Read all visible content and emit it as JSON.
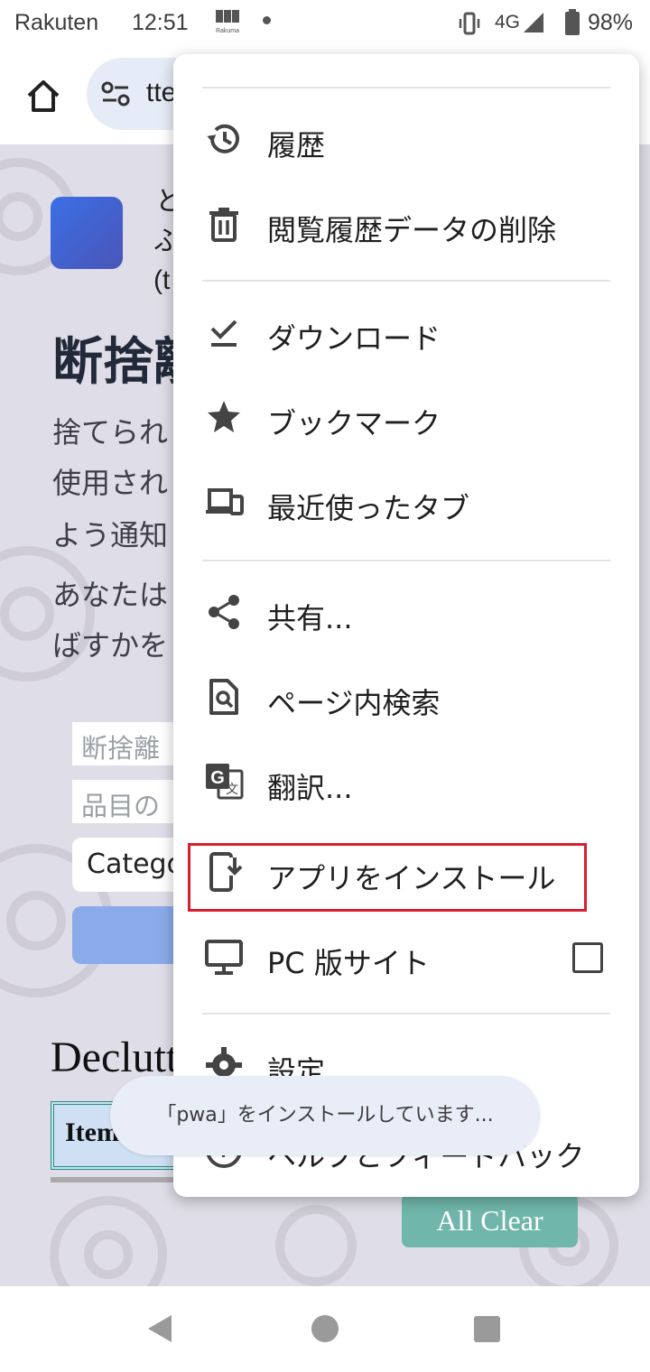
{
  "status_bar": {
    "carrier": "Rakuten",
    "time": "12:51",
    "app_icon_label": "Rakuma",
    "network": "4G",
    "battery_percent": "98%"
  },
  "toolbar": {
    "url_partial": "tte"
  },
  "page": {
    "header_lines": [
      "と",
      "ふ",
      "(t"
    ],
    "heading": "断捨離",
    "paragraph_lines": [
      "捨てられ",
      "使用され",
      "よう通知",
      "あなたは",
      "ばすかを"
    ],
    "field_1_placeholder": "断捨離",
    "field_2_placeholder": "品目の",
    "category_select": "Catego",
    "section_title": "Declutt",
    "table_header": "Item",
    "clear_button": "All Clear"
  },
  "menu": {
    "items": [
      {
        "label": "履歴",
        "icon": "history-icon"
      },
      {
        "label": "閲覧履歴データの削除",
        "icon": "trash-icon"
      },
      {
        "label": "ダウンロード",
        "icon": "download-done-icon"
      },
      {
        "label": "ブックマーク",
        "icon": "star-icon"
      },
      {
        "label": "最近使ったタブ",
        "icon": "devices-icon"
      },
      {
        "label": "共有...",
        "icon": "share-icon"
      },
      {
        "label": "ページ内検索",
        "icon": "find-in-page-icon"
      },
      {
        "label": "翻訳...",
        "icon": "translate-icon"
      },
      {
        "label": "アプリをインストール",
        "icon": "install-app-icon"
      },
      {
        "label": "PC 版サイト",
        "icon": "desktop-icon"
      },
      {
        "label": "設定",
        "icon": "gear-icon"
      },
      {
        "label": "ヘルプとフィードバック",
        "icon": "help-icon"
      }
    ],
    "desktop_site_checked": false,
    "highlight_color": "#d62030"
  },
  "toast": {
    "message": "「pwa」をインストールしています..."
  },
  "colors": {
    "page_background": "#dfdde7",
    "omnibox": "#e6ecf7",
    "clear_button": "#70b6ab"
  }
}
